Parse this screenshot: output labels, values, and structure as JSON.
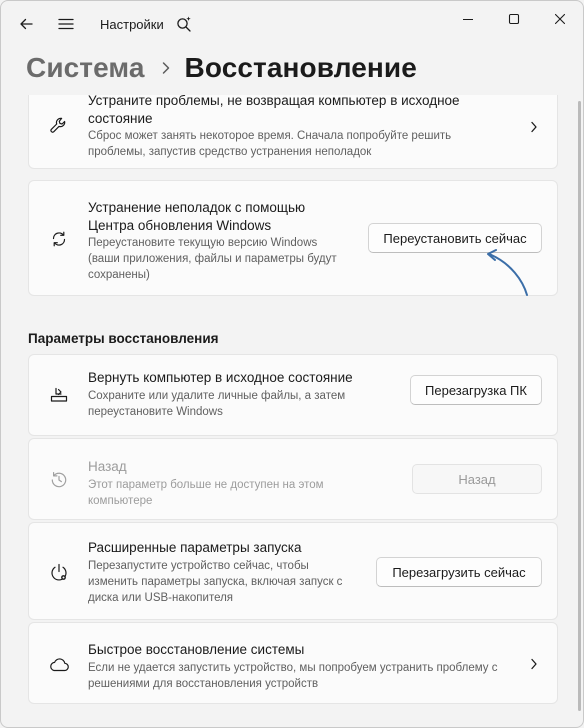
{
  "titlebar": {
    "app_title": "Настройки"
  },
  "header": {
    "crumb": "Система",
    "current": "Восстановление"
  },
  "cards": {
    "troubleshoot": {
      "title": "Устраните проблемы, не возвращая компьютер в исходное",
      "title2": "состояние",
      "desc": "Сброс может занять некоторое время. Сначала попробуйте решить",
      "desc2": "проблемы, запустив средство устранения неполадок"
    },
    "windows_update": {
      "title": "Устранение неполадок с помощью",
      "title2": "Центра обновления Windows",
      "desc": "Переустановите текущую версию Windows",
      "desc2": "(ваши приложения, файлы и параметры будут",
      "desc3": "сохранены)",
      "button": "Переустановить сейчас"
    }
  },
  "recovery": {
    "section_title": "Параметры восстановления",
    "reset": {
      "title": "Вернуть компьютер в исходное состояние",
      "desc": "Сохраните или удалите личные файлы, а затем",
      "desc2": "переустановите Windows",
      "button": "Перезагрузка ПК"
    },
    "go_back": {
      "title": "Назад",
      "desc": "Этот параметр больше не доступен на этом",
      "desc2": "компьютере",
      "button": "Назад"
    },
    "advanced": {
      "title": "Расширенные параметры запуска",
      "desc": "Перезапустите устройство сейчас, чтобы",
      "desc2": "изменить параметры запуска, включая запуск с",
      "desc3": "диска или USB-накопителя",
      "button": "Перезагрузить сейчас"
    },
    "quick": {
      "title": "Быстрое восстановление системы",
      "desc": "Если не удается запустить устройство, мы попробуем устранить проблему с",
      "desc2": "решениями для восстановления устройств"
    }
  },
  "colors": {
    "accent": "#0067c0",
    "annotation": "#3b6ea8"
  },
  "icons": [
    "back-arrow-icon",
    "hamburger-icon",
    "settings-search-icon",
    "minimize-icon",
    "maximize-icon",
    "close-icon",
    "wrench-icon",
    "refresh-icon",
    "reset-pc-icon",
    "history-icon",
    "power-settings-icon",
    "cloud-icon",
    "chevron-right-icon"
  ]
}
